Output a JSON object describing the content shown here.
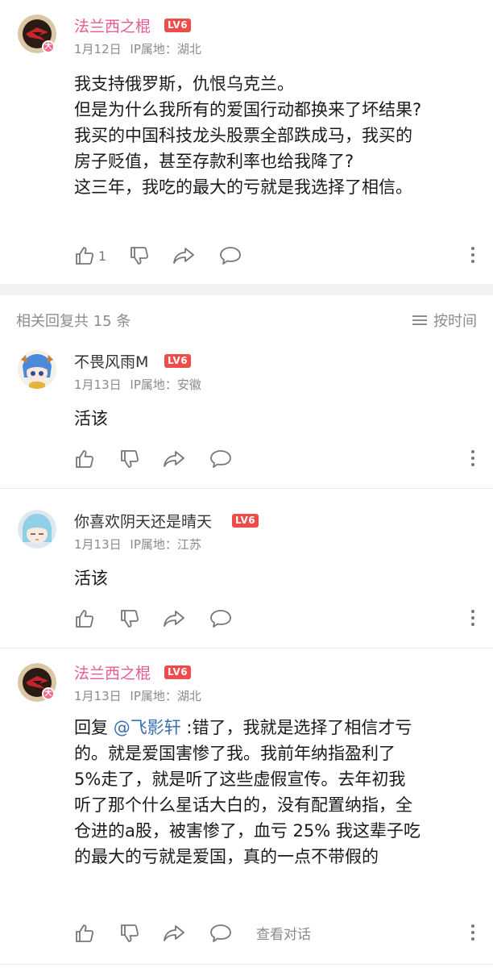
{
  "main_post": {
    "username": "法兰西之棍",
    "level": "LV6",
    "avatar_badge": "大",
    "date": "1月12日",
    "ip": "IP属地：湖北",
    "lines": [
      "我支持俄罗斯，仇恨乌克兰。",
      "但是为什么我所有的爱国行动都换来了坏结果?",
      "我买的中国科技龙头股票全部跌成马，我买的",
      "房子贬值，甚至存款利率也给我降了?",
      "这三年，我吃的最大的亏就是我选择了相信。"
    ],
    "like_count": "1"
  },
  "replies_header": {
    "count_text": "相关回复共 15 条",
    "sort_label": "按时间"
  },
  "replies": [
    {
      "username": "不畏风雨M",
      "level": "LV6",
      "date": "1月13日",
      "ip": "IP属地：安徽",
      "text": "活该"
    },
    {
      "username": "你喜欢阴天还是晴天",
      "level": "LV6",
      "date": "1月13日",
      "ip": "IP属地：江苏",
      "text": "活该"
    },
    {
      "username": "法兰西之棍",
      "level": "LV6",
      "avatar_badge": "大",
      "date": "1月13日",
      "ip": "IP属地：湖北",
      "reply_prefix": "回复 ",
      "mention": "@飞影轩",
      "line1_rest": " :错了，我就是选择了相信才亏",
      "lines": [
        "的。就是爱国害惨了我。我前年纳指盈利了",
        "5%走了，就是听了这些虚假宣传。去年初我",
        "听了那个什么星话大白的，没有配置纳指，全",
        "仓进的a股，被害惨了，血亏 25%  我这辈子吃",
        "的最大的亏就是爱国，真的一点不带假的"
      ],
      "view_conversation": "查看对话"
    }
  ],
  "icons": {
    "like": "thumbs-up-icon",
    "dislike": "thumbs-down-icon",
    "share": "share-arrow-icon",
    "comment": "comment-bubble-icon",
    "more": "more-vertical-icon",
    "sort": "sort-lines-icon"
  },
  "colors": {
    "username_pink": "#e75a93",
    "level_badge": "#f04a4a",
    "mention_blue": "#3b6fb3",
    "meta_gray": "#8a8a8a"
  }
}
